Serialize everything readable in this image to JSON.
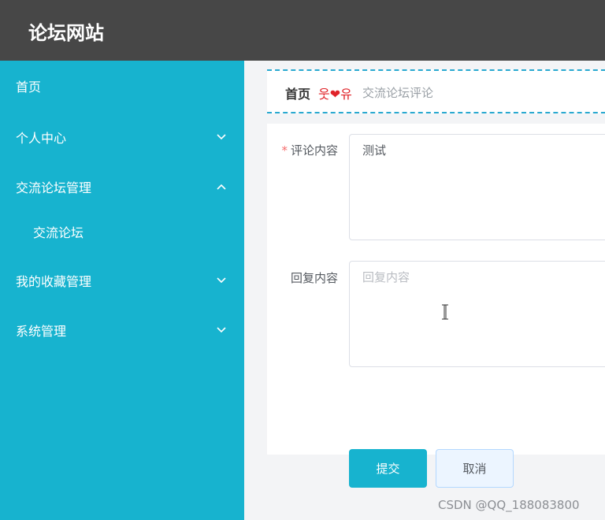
{
  "header": {
    "site_title": "论坛网站"
  },
  "sidebar": {
    "items": [
      {
        "label": "首页",
        "expanded": null
      },
      {
        "label": "个人中心",
        "expanded": false
      },
      {
        "label": "交流论坛管理",
        "expanded": true
      },
      {
        "label": "交流论坛",
        "sub": true
      },
      {
        "label": "我的收藏管理",
        "expanded": false
      },
      {
        "label": "系统管理",
        "expanded": false
      }
    ]
  },
  "breadcrumb": {
    "home": "首页",
    "decoration": "웃❤유",
    "current": "交流论坛评论"
  },
  "form": {
    "comment_label": "评论内容",
    "comment_required_mark": "*",
    "comment_value": "测试",
    "reply_label": "回复内容",
    "reply_placeholder": "回复内容",
    "reply_value": ""
  },
  "buttons": {
    "submit_label": "提交",
    "cancel_label": "取消"
  },
  "watermark": "CSDN @QQ_188083800",
  "colors": {
    "topbar": "#474747",
    "sidebar": "#17b3cf",
    "accent": "#17b3cf",
    "dashed_border": "#29a9d0",
    "heart": "#e0242a"
  }
}
